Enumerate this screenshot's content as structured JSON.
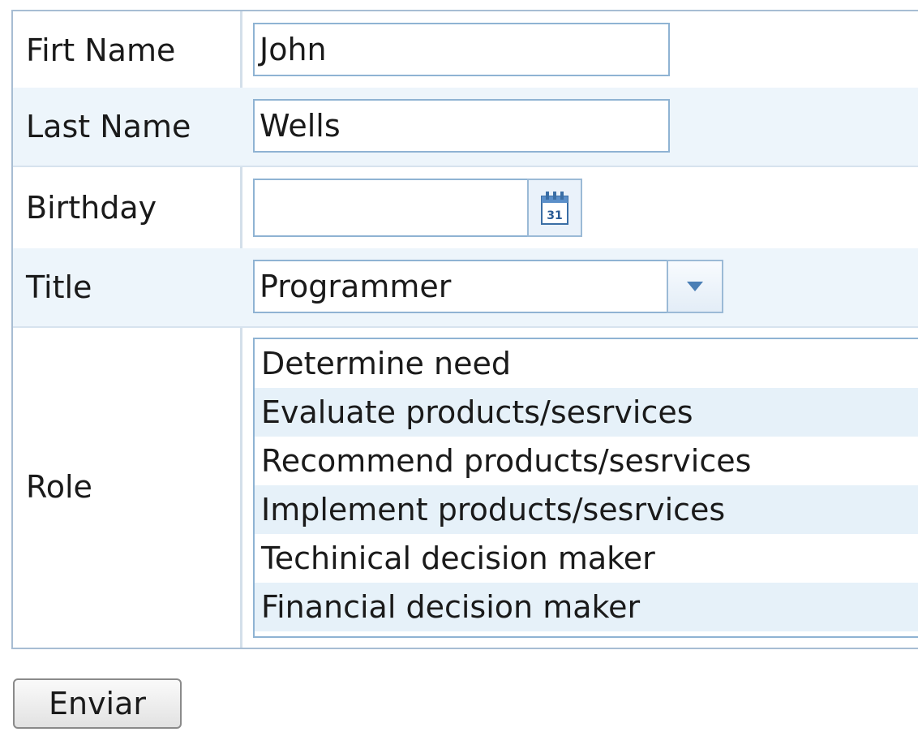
{
  "form": {
    "first_name": {
      "label": "Firt Name",
      "value": "John"
    },
    "last_name": {
      "label": "Last Name",
      "value": "Wells"
    },
    "birthday": {
      "label": "Birthday",
      "value": "",
      "calendar_icon_text": "31"
    },
    "title": {
      "label": "Title",
      "value": "Programmer"
    },
    "role": {
      "label": "Role",
      "options": [
        "Determine need",
        "Evaluate products/sesrvices",
        "Recommend products/sesrvices",
        "Implement products/sesrvices",
        "Techinical decision maker",
        "Financial decision maker"
      ]
    }
  },
  "submit_label": "Enviar",
  "icons": {
    "calendar": "calendar-icon",
    "dropdown": "chevron-down-icon"
  },
  "colors": {
    "border": "#a7bdd3",
    "alt_row": "#edf5fb",
    "field_border": "#8fb3d3",
    "arrow": "#4a7fb5"
  }
}
